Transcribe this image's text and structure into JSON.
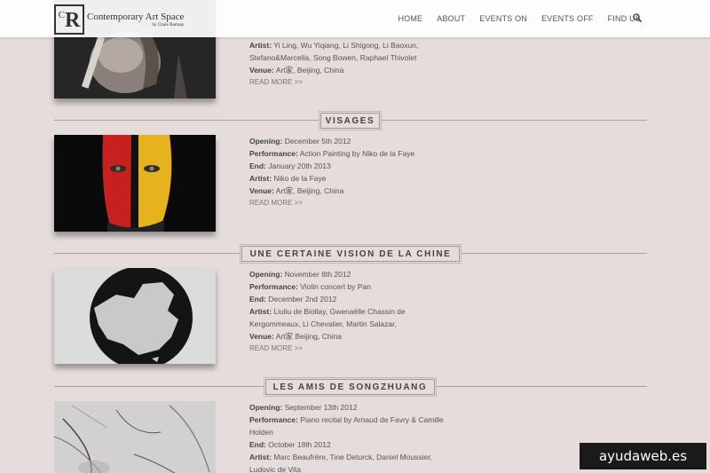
{
  "brand": {
    "logo_c": "C",
    "logo_r": "R",
    "name": "Contemporary Art Space",
    "byline": "by Claire Ramsay"
  },
  "nav": {
    "items": [
      "HOME",
      "ABOUT",
      "EVENTS ON",
      "EVENTS OFF",
      "FIND US"
    ]
  },
  "labels": {
    "opening": "Opening:",
    "performance": "Performance:",
    "end": "End:",
    "artist": "Artist:",
    "venue": "Venue:",
    "read_more": "READ MORE >>"
  },
  "events": [
    {
      "title": "",
      "opening": "",
      "performance": "",
      "end": "",
      "artist_line1": "Yi Ling, Wu Yiqiang, Li Shigong, Li Baoxun,",
      "artist_line2": "Stefano&Marcella, Song Bowen, Raphael Thivolet",
      "venue": "Art家, Beijing, China"
    },
    {
      "title": "VISAGES",
      "opening": "December 5th 2012",
      "performance": "Action Painting by Niko de la Faye",
      "end": "January 20th 2013",
      "artist_line1": "Niko de la Faye",
      "venue": "Art家, Beijing, China"
    },
    {
      "title": "UNE CERTAINE VISION DE LA CHINE",
      "opening": "November 8th 2012",
      "performance": "Violin concert by Pan",
      "end": "December 2nd 2012",
      "artist_line1": "Liuliu de Biollay, Gwenaëlle Chassin de",
      "artist_line2": "Kergommeaux, Li Chevalier, Martin Salazar,",
      "venue": "Art家 Beijing, China"
    },
    {
      "title": "LES AMIS DE SONGZHUANG",
      "opening": "September 13th 2012",
      "performance_line1": "Piano recital by Arnaud de Favry & Camille",
      "performance_line2": "Holden",
      "end": "October 18th 2012",
      "artist_line1": "Marc Beaufrère, Tine Deturck, Daniel Moussier,",
      "artist_line2": "Ludovic de Vita"
    }
  ],
  "watermark": "ayudaweb.es"
}
